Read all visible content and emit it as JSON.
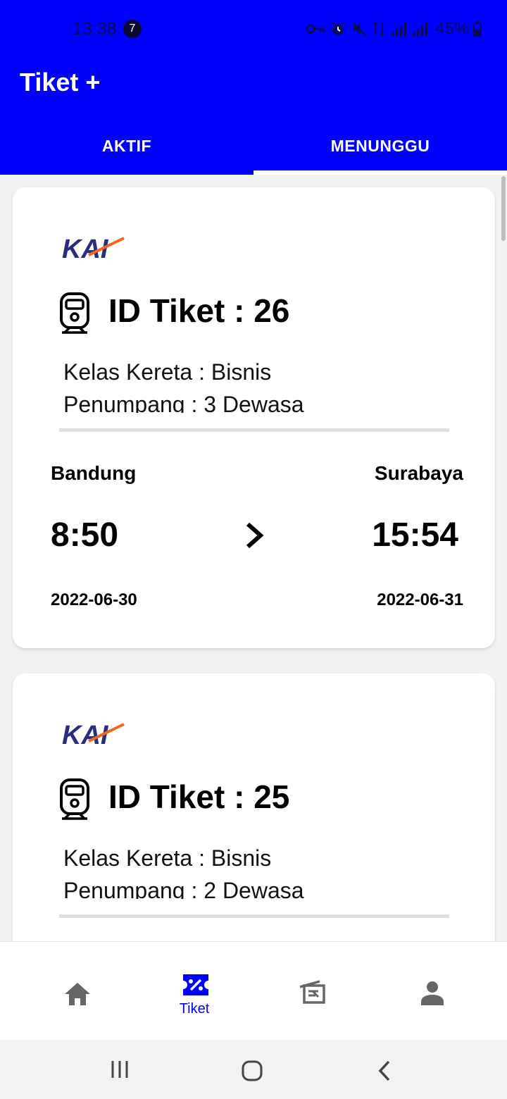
{
  "status_bar": {
    "time": "13:38",
    "notification_count": "7",
    "battery": "45%"
  },
  "app_title": "Tiket +",
  "tabs": [
    {
      "label": "AKTIF"
    },
    {
      "label": "MENUNGGU"
    }
  ],
  "selected_tab": "MENUNGGU",
  "tickets": [
    {
      "logo": "KAI",
      "id_line": "ID Tiket : 26",
      "class_line": "Kelas Kereta : Bisnis",
      "passenger_line": "Penumpang  : 3 Dewasa",
      "origin": "Bandung",
      "destination": "Surabaya",
      "departure_time": "8:50",
      "arrival_time": "15:54",
      "departure_date": "2022-06-30",
      "arrival_date": "2022-06-31"
    },
    {
      "logo": "KAI",
      "id_line": "ID Tiket : 25",
      "class_line": "Kelas Kereta : Bisnis",
      "passenger_line": "Penumpang  : 2 Dewasa"
    }
  ],
  "bottom_nav": {
    "items": [
      {
        "icon": "home-icon",
        "label": ""
      },
      {
        "icon": "ticket-icon",
        "label": "Tiket"
      },
      {
        "icon": "history-icon",
        "label": ""
      },
      {
        "icon": "person-icon",
        "label": ""
      }
    ],
    "active": "Tiket"
  },
  "colors": {
    "primary": "#0000ff",
    "card_background": "#ffffff",
    "page_background": "#f1f1f1",
    "kai_navy": "#2a2d7c",
    "kai_orange": "#f26522"
  }
}
